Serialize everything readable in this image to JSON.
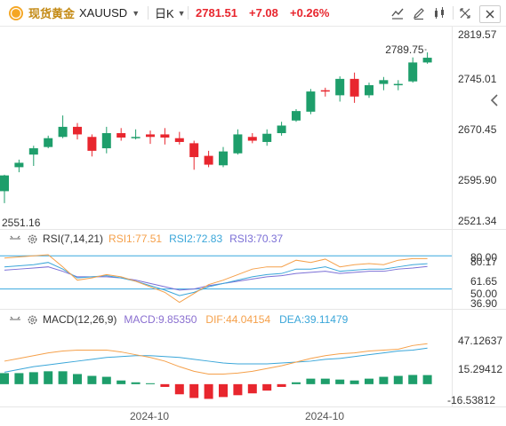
{
  "header": {
    "instrument_name": "现货黄金",
    "symbol": "XAUUSD",
    "timeframe": "日K",
    "last_price": "2781.51",
    "change": "+7.08",
    "change_pct": "+0.26%"
  },
  "toolbar_icons": [
    "candle-style-icon",
    "draw-icon",
    "indicator-icon",
    "fullscreen-icon",
    "close-icon"
  ],
  "colors": {
    "up": "#1e9e6b",
    "down": "#e8262e",
    "rsi1": "#f5a04a",
    "rsi2": "#3aa6d9",
    "rsi3": "#7b6fd6",
    "macd": "#333333",
    "dif": "#f5a04a",
    "dea": "#3aa6d9",
    "level": "#39a7de"
  },
  "price_pane": {
    "y_axis_labels": [
      "2819.57",
      "2745.01",
      "2670.45",
      "2595.90",
      "2521.34"
    ],
    "max_label": "2789.75",
    "min_label": "2551.16",
    "axis_range": [
      2521.34,
      2819.57
    ]
  },
  "rsi_pane": {
    "title": "RSI(7,14,21)",
    "rsi1": "RSI1:77.51",
    "rsi2": "RSI2:72.83",
    "rsi3": "RSI3:70.37",
    "y_axis_labels": [
      "80.00",
      "80.17",
      "61.65",
      "50.00",
      "36.90"
    ],
    "axis_range": [
      36.9,
      80.17
    ],
    "levels": [
      80,
      50
    ]
  },
  "macd_pane": {
    "title": "MACD(12,26,9)",
    "macd": "MACD:9.85350",
    "dif": "DIF:44.04154",
    "dea": "DEA:39.11479",
    "y_axis_labels": [
      "47.12637",
      "15.29412",
      "-16.53812"
    ],
    "axis_range": [
      -16.53812,
      47.12637
    ]
  },
  "x_axis_labels": [
    "2024-10",
    "2024-10"
  ],
  "chart_data": {
    "type": "candlestick",
    "candles": [
      {
        "o": 2570,
        "h": 2596,
        "l": 2551,
        "c": 2595
      },
      {
        "o": 2608,
        "h": 2620,
        "l": 2600,
        "c": 2615
      },
      {
        "o": 2628,
        "h": 2642,
        "l": 2610,
        "c": 2638
      },
      {
        "o": 2640,
        "h": 2658,
        "l": 2638,
        "c": 2654
      },
      {
        "o": 2656,
        "h": 2690,
        "l": 2654,
        "c": 2672
      },
      {
        "o": 2672,
        "h": 2678,
        "l": 2652,
        "c": 2660
      },
      {
        "o": 2656,
        "h": 2660,
        "l": 2625,
        "c": 2634
      },
      {
        "o": 2638,
        "h": 2672,
        "l": 2630,
        "c": 2662
      },
      {
        "o": 2662,
        "h": 2670,
        "l": 2650,
        "c": 2655
      },
      {
        "o": 2656,
        "h": 2668,
        "l": 2652,
        "c": 2656
      },
      {
        "o": 2660,
        "h": 2666,
        "l": 2645,
        "c": 2656
      },
      {
        "o": 2660,
        "h": 2670,
        "l": 2644,
        "c": 2655
      },
      {
        "o": 2654,
        "h": 2664,
        "l": 2644,
        "c": 2648
      },
      {
        "o": 2646,
        "h": 2650,
        "l": 2604,
        "c": 2624
      },
      {
        "o": 2626,
        "h": 2634,
        "l": 2608,
        "c": 2612
      },
      {
        "o": 2611,
        "h": 2640,
        "l": 2608,
        "c": 2633
      },
      {
        "o": 2630,
        "h": 2668,
        "l": 2628,
        "c": 2660
      },
      {
        "o": 2656,
        "h": 2662,
        "l": 2646,
        "c": 2650
      },
      {
        "o": 2648,
        "h": 2668,
        "l": 2642,
        "c": 2661
      },
      {
        "o": 2662,
        "h": 2680,
        "l": 2658,
        "c": 2674
      },
      {
        "o": 2682,
        "h": 2700,
        "l": 2680,
        "c": 2697
      },
      {
        "o": 2696,
        "h": 2732,
        "l": 2692,
        "c": 2728
      },
      {
        "o": 2730,
        "h": 2734,
        "l": 2720,
        "c": 2728
      },
      {
        "o": 2722,
        "h": 2752,
        "l": 2712,
        "c": 2748
      },
      {
        "o": 2748,
        "h": 2758,
        "l": 2710,
        "c": 2720
      },
      {
        "o": 2722,
        "h": 2742,
        "l": 2718,
        "c": 2738
      },
      {
        "o": 2740,
        "h": 2751,
        "l": 2730,
        "c": 2746
      },
      {
        "o": 2738,
        "h": 2746,
        "l": 2730,
        "c": 2740
      },
      {
        "o": 2744,
        "h": 2782,
        "l": 2742,
        "c": 2774
      },
      {
        "o": 2774,
        "h": 2790,
        "l": 2772,
        "c": 2781.51
      }
    ],
    "rsi": {
      "rsi1": [
        78,
        79,
        80,
        81,
        70,
        58,
        60,
        63,
        61,
        57,
        52,
        47,
        38,
        46,
        54,
        58,
        63,
        68,
        70,
        70,
        76,
        74,
        77,
        70,
        72,
        73,
        72,
        76,
        77.5,
        77.51
      ],
      "rsi2": [
        70,
        71,
        72,
        74,
        68,
        60,
        61,
        62,
        60,
        57,
        53,
        49,
        44,
        47,
        52,
        55,
        58,
        61,
        63,
        64,
        68,
        68,
        70,
        66,
        67,
        68,
        68,
        70,
        72,
        72.83
      ],
      "rsi3": [
        67,
        68,
        69,
        70,
        66,
        61,
        61,
        61,
        60,
        58,
        55,
        52,
        49,
        50,
        53,
        55,
        57,
        59,
        61,
        62,
        64,
        65,
        66,
        64,
        65,
        66,
        66,
        68,
        69,
        70.37
      ]
    },
    "macd": {
      "hist": [
        12,
        12,
        13,
        14,
        14,
        11,
        9,
        8,
        4,
        2,
        1,
        -3,
        -11,
        -15,
        -16,
        -14,
        -12,
        -10,
        -7,
        -3,
        2,
        6,
        6,
        5,
        4,
        6,
        8,
        9,
        10,
        9.8535
      ],
      "dif": [
        25,
        28,
        31,
        34,
        36,
        37,
        37,
        37,
        35,
        32,
        29,
        25,
        19,
        14,
        11,
        11,
        12,
        14,
        17,
        20,
        24,
        28,
        31,
        33,
        34,
        36,
        37,
        38,
        42,
        44.04154
      ],
      "dea": [
        13,
        16,
        19,
        21,
        23,
        25,
        27,
        29,
        30,
        31,
        31,
        30,
        29,
        27,
        25,
        23,
        22,
        22,
        22,
        23,
        24,
        25,
        27,
        28,
        30,
        32,
        34,
        36,
        37,
        39.11479
      ]
    }
  }
}
